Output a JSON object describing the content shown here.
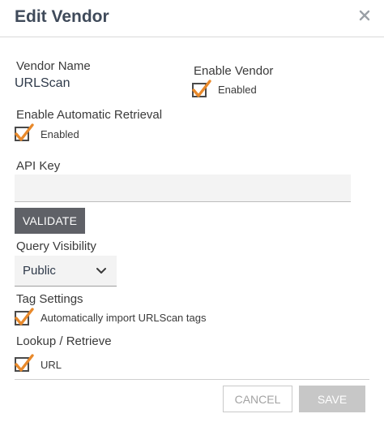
{
  "dialog": {
    "title": "Edit Vendor",
    "close_icon": "close-icon"
  },
  "vendor_name": {
    "label": "Vendor Name",
    "value": "URLScan"
  },
  "enable_vendor": {
    "label": "Enable Vendor",
    "checkbox_label": "Enabled",
    "checked": true
  },
  "auto_retrieval": {
    "label": "Enable Automatic Retrieval",
    "checkbox_label": "Enabled",
    "checked": true
  },
  "api_key": {
    "label": "API Key",
    "value": "",
    "validate_label": "VALIDATE"
  },
  "query_visibility": {
    "label": "Query Visibility",
    "selected": "Public"
  },
  "tag_settings": {
    "label": "Tag Settings",
    "checkbox_label": "Automatically import URLScan tags",
    "checked": true
  },
  "lookup": {
    "label": "Lookup / Retrieve",
    "checkbox_label": "URL",
    "checked": true
  },
  "footer": {
    "cancel_label": "CANCEL",
    "save_label": "SAVE"
  },
  "colors": {
    "check_mark": "#e8892b",
    "title": "#3f4a5a",
    "validate_bg": "#5f6167",
    "save_bg": "#c7c7c7"
  }
}
